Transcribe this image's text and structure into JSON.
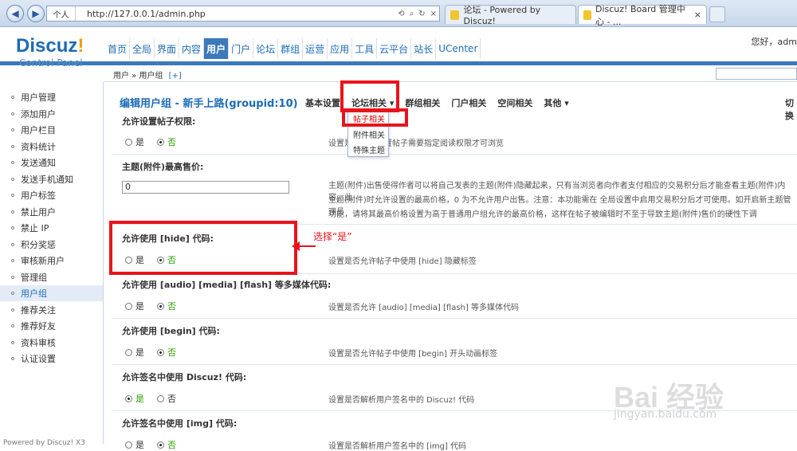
{
  "browser": {
    "zone": "个人",
    "url": "http://127.0.0.1/admin.php",
    "tabs": [
      {
        "label": "论坛 - Powered by Discuz!"
      },
      {
        "label": "Discuz! Board 管理中心 - ..."
      }
    ]
  },
  "header": {
    "logo_main": "Discuz",
    "logo_bang": "!",
    "logo_sub": "Control Panel",
    "nav": [
      "首页",
      "全局",
      "界面",
      "内容",
      "用户",
      "门户",
      "论坛",
      "群组",
      "运营",
      "应用",
      "工具",
      "云平台",
      "站长",
      "UCenter"
    ],
    "active_nav": "用户",
    "greeting": "您好，adm"
  },
  "breadcrumb": {
    "text": "用户 » 用户组",
    "add": "[+]"
  },
  "sidebar": {
    "items": [
      "用户管理",
      "添加用户",
      "用户栏目",
      "资料统计",
      "发送通知",
      "发送手机通知",
      "用户标签",
      "禁止用户",
      "禁止 IP",
      "积分奖惩",
      "审核新用户",
      "管理组",
      "用户组",
      "推荐关注",
      "推荐好友",
      "资料审核",
      "认证设置"
    ],
    "active": "用户组",
    "powered": "Powered by Discuz! X3"
  },
  "page": {
    "title": "编辑用户组 - 新手上路(groupid:10)",
    "subtabs": [
      "基本设置",
      "论坛相关 ▾",
      "群组相关",
      "门户相关",
      "空间相关",
      "其他 ▾"
    ],
    "cut": "切换",
    "dropdown": [
      "帖子相关",
      "附件相关",
      "特殊主题"
    ]
  },
  "settings": [
    {
      "label": "允许设置帖子权限:",
      "yes": "是",
      "no": "否",
      "value": "no",
      "hint": "设置是否允许设置帖子需要指定阅读权限才可浏览"
    },
    {
      "label": "主题(附件)最高售价:",
      "input": "0",
      "hint": "主题(附件)出售使得作者可以将自己发表的主题(附件)隐藏起来，只有当浏览者向作者支付相应的交易积分后才能查看主题(附件)内容。此",
      "hint2": "主题(附件)时允许设置的最高价格，0 为不允许用户出售。注意：本功能需在 全局设置中启用交易积分后才可使用。如开启新主题管理员",
      "hint3": "功能，请将其最高价格设置为高于普通用户组允许的最高价格，这样在帖子被编辑时不至于导致主题(附件)售价的硬性下调"
    },
    {
      "label": "允许使用 [hide] 代码:",
      "yes": "是",
      "no": "否",
      "value": "no",
      "hint": "设置是否允许帖子中使用 [hide] 隐藏标签"
    },
    {
      "label": "允许使用 [audio] [media] [flash] 等多媒体代码:",
      "yes": "是",
      "no": "否",
      "value": "no",
      "hint": "设置是否允许 [audio] [media] [flash] 等多媒体代码"
    },
    {
      "label": "允许使用 [begin] 代码:",
      "yes": "是",
      "no": "否",
      "value": "no",
      "hint": "设置是否允许帖子中使用 [begin] 开头动画标签"
    },
    {
      "label": "允许签名中使用 Discuz! 代码:",
      "yes": "是",
      "no": "否",
      "value": "yes",
      "hint": "设置是否解析用户签名中的 Discuz! 代码"
    },
    {
      "label": "允许签名中使用 [img] 代码:",
      "yes": "是",
      "no": "否",
      "value": "no",
      "hint": "设置是否解析用户签名中的 [img] 代码"
    }
  ],
  "annotation": {
    "text": "选择“是”",
    "color": "#e8141b"
  },
  "watermark": {
    "main": "Bai 经验",
    "sub": "jingyan.baidu.com"
  },
  "colors": {
    "accent": "#3b79b9",
    "link": "#1c6bb5",
    "highlight": "#e8141b",
    "checked": "#2aa000"
  }
}
